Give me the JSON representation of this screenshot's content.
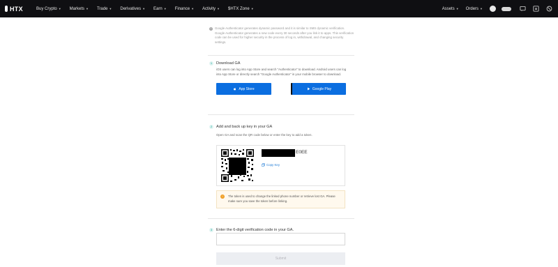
{
  "nav": {
    "logo": "HTX",
    "items": [
      {
        "label": "Buy Crypto",
        "caret": true
      },
      {
        "label": "Markets",
        "caret": true
      },
      {
        "label": "Trade",
        "caret": true
      },
      {
        "label": "Derivatives",
        "caret": true
      },
      {
        "label": "Earn",
        "caret": true
      },
      {
        "label": "Finance",
        "caret": true
      },
      {
        "label": "Activity",
        "caret": true
      },
      {
        "label": "$HTX Zone",
        "caret": true
      }
    ],
    "right": {
      "assets": "Assets",
      "orders": "Orders"
    }
  },
  "intro": "Google Authenticator generates dynamic password and it is similar to SMS dynamic verification. Google Authenticator generates a new code every 30 seconds after you link it to apps. This verification code can be used for higher security in the process of log in, withdrawal, and changing security settings.",
  "steps": [
    {
      "num": "1",
      "title": "Download GA",
      "desc": "iOS users can log into App Store and search \"Authenticator\" to download. Android users can log into App Store or directly search \"Google Authenticator\" in your mobile browser to download.",
      "buttons": [
        "App Store",
        "Google Play"
      ]
    },
    {
      "num": "2",
      "title": "Add and back up key in your GA",
      "desc": "Open GA and scan the QR code below or enter the key to add a token.",
      "key_suffix": "E0EE",
      "copy_label": "Copy Key",
      "warning": "The token is used to change the linked phone number or retrieve lost GA. Please make sure you save the token before linking."
    },
    {
      "num": "3",
      "title": "Enter the 6-digit verification code in your GA.",
      "input_value": "",
      "submit_label": "Submit"
    }
  ],
  "colors": {
    "nav_bg": "#0f0f12",
    "button_blue": "#0b6ee0",
    "accent_teal": "#16a99b",
    "link_blue": "#1b79d5",
    "warning_orange": "#f0a028"
  }
}
